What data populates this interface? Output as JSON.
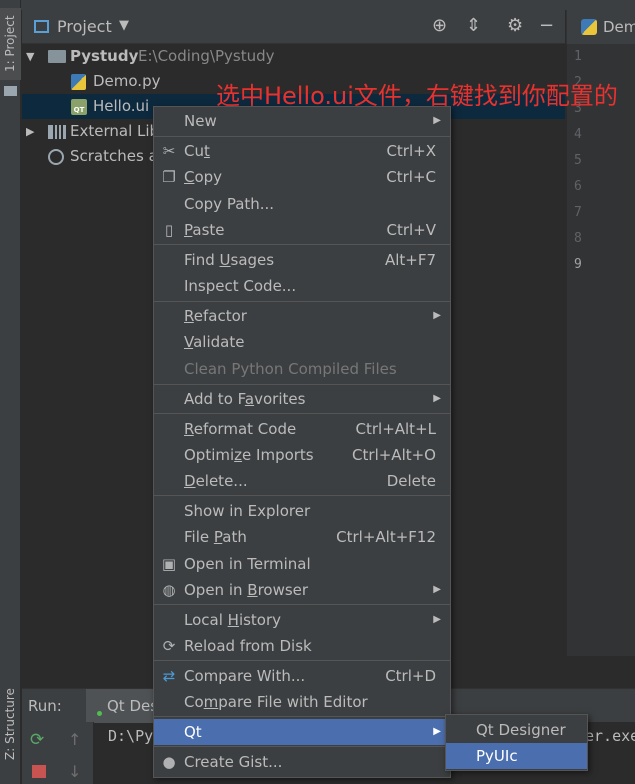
{
  "sidebar": {
    "project_tab": "1: Project",
    "structure_tab": "Z: Structure"
  },
  "project_panel": {
    "title": "Project",
    "tree": [
      {
        "name": "Pystudy",
        "path": "E:\\Coding\\Pystudy"
      },
      {
        "name": "Demo.py"
      },
      {
        "name": "Hello.ui"
      },
      {
        "name": "External Lib"
      },
      {
        "name": "Scratches a"
      }
    ]
  },
  "editor": {
    "tab": "Demo",
    "line_numbers": [
      "1",
      "2",
      "3",
      "4",
      "5",
      "6",
      "7",
      "8",
      "9"
    ]
  },
  "annotation": {
    "text": "选中Hello.ui文件，右键找到你配置的PyUIc"
  },
  "run": {
    "label": "Run:",
    "tab": "Qt Des",
    "output_start": "D:\\Py",
    "output_end": "er.exe"
  },
  "context_menu": {
    "items": [
      {
        "label": "New",
        "submenu": true
      },
      {
        "label_pre": "Cu",
        "label_u": "t",
        "label_post": "",
        "shortcut": "Ctrl+X",
        "icon": "scissors-icon"
      },
      {
        "label_pre": "",
        "label_u": "C",
        "label_post": "opy",
        "shortcut": "Ctrl+C",
        "icon": "copy-icon"
      },
      {
        "label": "Copy Path...",
        "shortcut": ""
      },
      {
        "label_pre": "",
        "label_u": "P",
        "label_post": "aste",
        "shortcut": "Ctrl+V",
        "icon": "paste-icon"
      },
      {
        "label_pre": "Find ",
        "label_u": "U",
        "label_post": "sages",
        "shortcut": "Alt+F7"
      },
      {
        "label": "Inspect Code...",
        "shortcut": ""
      },
      {
        "label_pre": "",
        "label_u": "R",
        "label_post": "efactor",
        "submenu": true
      },
      {
        "label_pre": "",
        "label_u": "V",
        "label_post": "alidate"
      },
      {
        "label": "Clean Python Compiled Files",
        "disabled": true
      },
      {
        "label_pre": "Add to F",
        "label_u": "a",
        "label_post": "vorites",
        "submenu": true
      },
      {
        "label_pre": "",
        "label_u": "R",
        "label_post": "eformat Code",
        "shortcut": "Ctrl+Alt+L"
      },
      {
        "label_pre": "Optimi",
        "label_u": "z",
        "label_post": "e Imports",
        "shortcut": "Ctrl+Alt+O"
      },
      {
        "label_pre": "",
        "label_u": "D",
        "label_post": "elete...",
        "shortcut": "Delete"
      },
      {
        "label": "Show in Explorer"
      },
      {
        "label_pre": "File ",
        "label_u": "P",
        "label_post": "ath",
        "shortcut": "Ctrl+Alt+F12"
      },
      {
        "label": "Open in Terminal",
        "icon": "terminal-icon"
      },
      {
        "label_pre": "Open in ",
        "label_u": "B",
        "label_post": "rowser",
        "submenu": true,
        "icon": "globe-icon"
      },
      {
        "label_pre": "Local ",
        "label_u": "H",
        "label_post": "istory",
        "submenu": true
      },
      {
        "label": "Reload from Disk",
        "icon": "reload-icon"
      },
      {
        "label": "Compare With...",
        "shortcut": "Ctrl+D",
        "icon": "compare-icon"
      },
      {
        "label_pre": "Co",
        "label_u": "m",
        "label_post": "pare File with Editor"
      },
      {
        "label": "Qt",
        "submenu": true,
        "active": true
      },
      {
        "label": "Create Gist...",
        "icon": "github-icon"
      }
    ]
  },
  "qt_submenu": {
    "items": [
      {
        "label": "Qt Designer"
      },
      {
        "label": "PyUIc",
        "active": true
      }
    ]
  },
  "colors": {
    "accent": "#4b6eaf",
    "annotation": "#e8322f",
    "background": "#2b2b2b",
    "panel": "#3c3f41"
  }
}
